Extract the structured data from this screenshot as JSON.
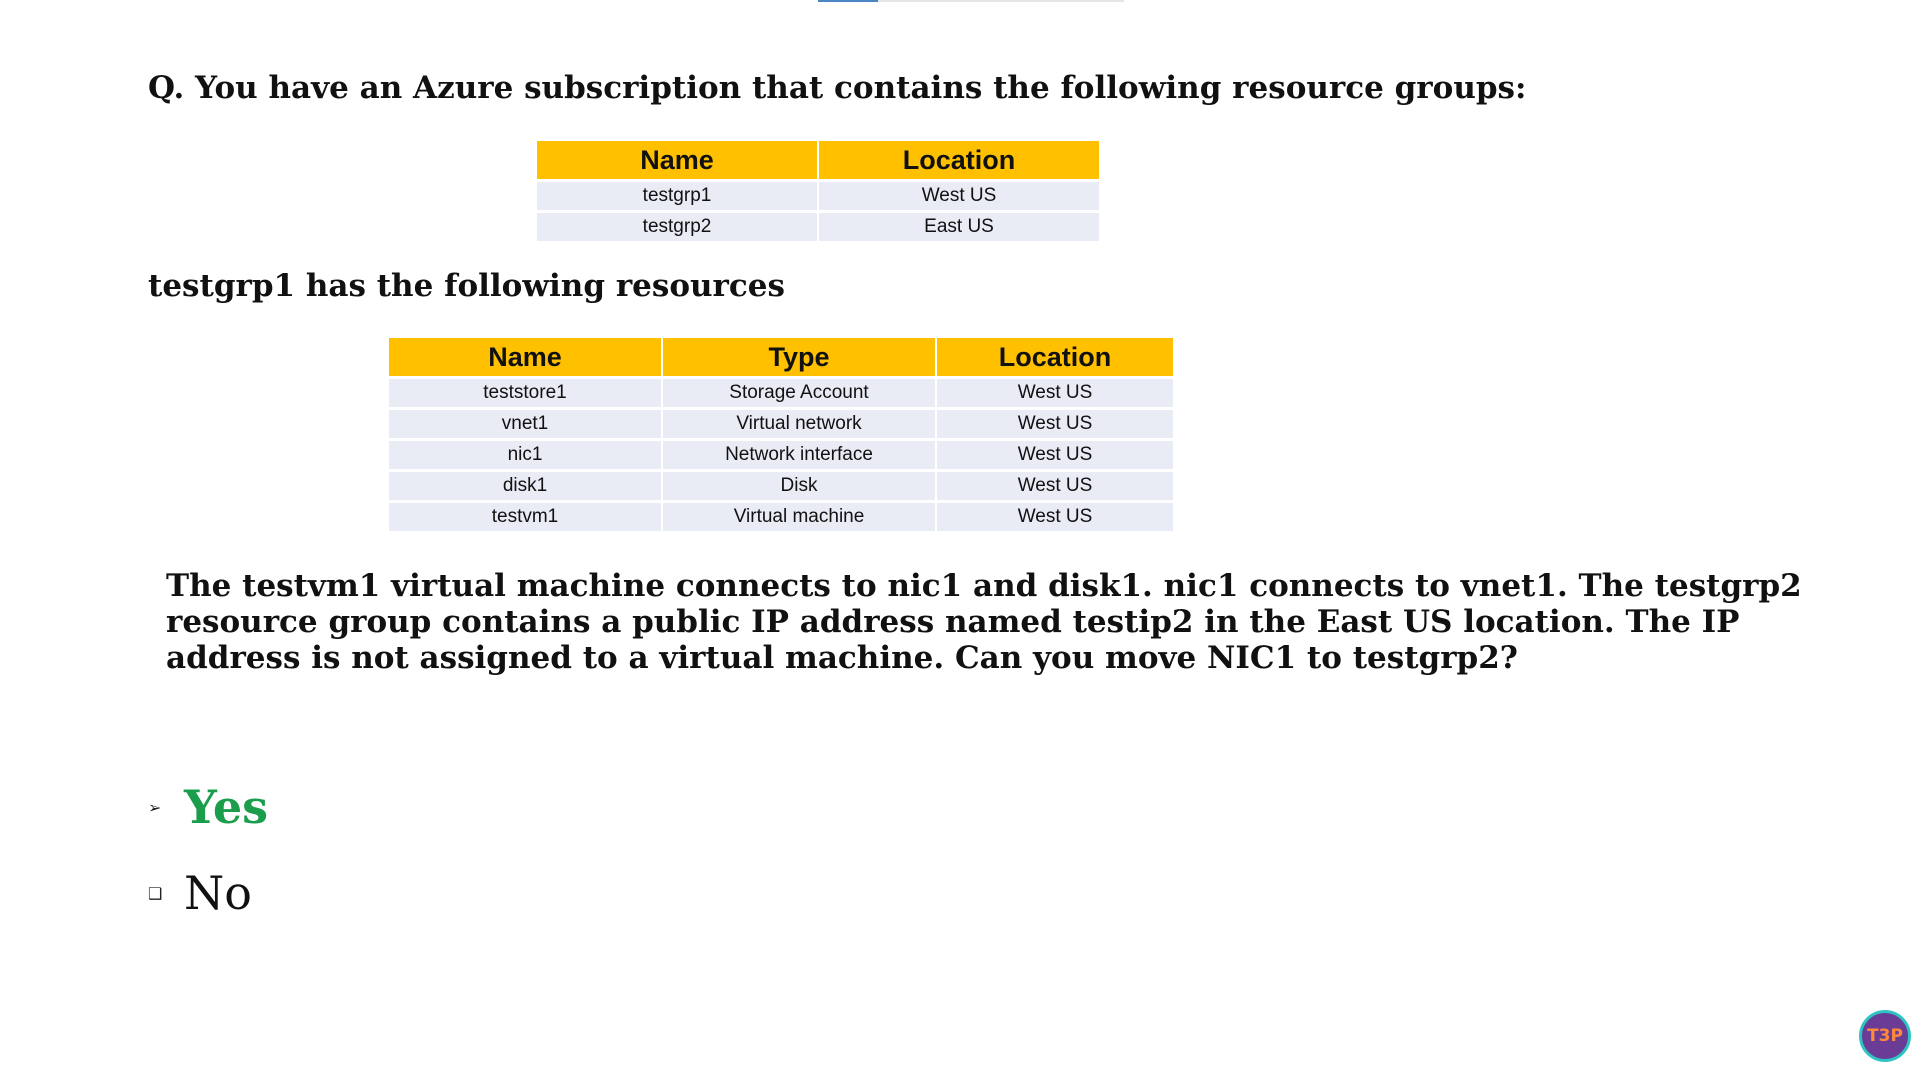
{
  "question": {
    "title": "Q. You have an Azure subscription that contains the following resource groups:"
  },
  "resource_groups_table": {
    "headers": [
      "Name",
      "Location"
    ],
    "rows": [
      [
        "testgrp1",
        "West US"
      ],
      [
        "testgrp2",
        "East US"
      ]
    ]
  },
  "resources_heading": "testgrp1 has the following resources",
  "resources_table": {
    "headers": [
      "Name",
      "Type",
      "Location"
    ],
    "rows": [
      [
        "teststore1",
        "Storage Account",
        "West US"
      ],
      [
        "vnet1",
        "Virtual network",
        "West US"
      ],
      [
        "nic1",
        "Network interface",
        "West US"
      ],
      [
        "disk1",
        "Disk",
        "West US"
      ],
      [
        "testvm1",
        "Virtual machine",
        "West US"
      ]
    ]
  },
  "question_body": "The testvm1 virtual machine connects to nic1 and disk1. nic1 connects to vnet1. The testgrp2 resource group contains a public IP address named testip2 in the East US location. The IP address is not assigned to a virtual machine. Can you move NIC1 to testgrp2?",
  "options": [
    {
      "label": "Yes",
      "marker": "➢",
      "marker_icon": "arrow-bullet-icon",
      "correct": true,
      "color": "#1a9e4b"
    },
    {
      "label": "No",
      "marker": "❑",
      "marker_icon": "square-bullet-icon",
      "correct": false,
      "color": "#111111"
    }
  ],
  "logo": {
    "text": "T3P"
  },
  "colors": {
    "header_fill": "#ffc000",
    "row_fill": "#e9ebf5",
    "correct_answer": "#1a9e4b"
  }
}
